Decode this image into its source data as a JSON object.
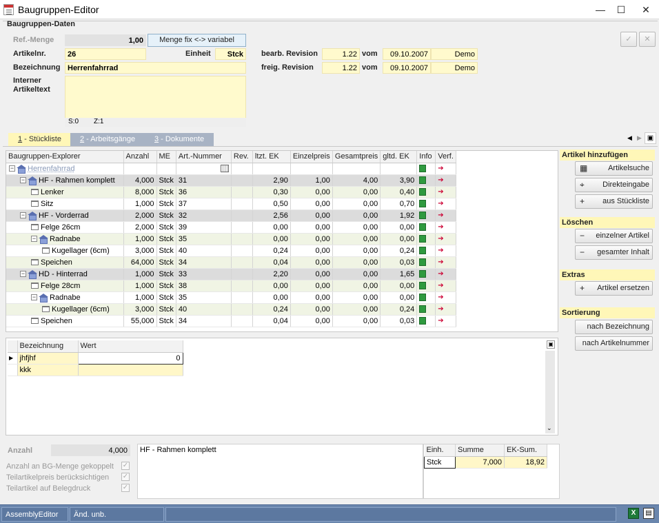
{
  "window": {
    "title": "Baugruppen-Editor",
    "min": "—",
    "max": "☐",
    "close": "✕"
  },
  "header": {
    "section": "Baugruppen-Daten",
    "ref_menge_label": "Ref.-Menge",
    "ref_menge_value": "1,00",
    "menge_button": "Menge fix <-> variabel",
    "artikelnr_label": "Artikelnr.",
    "artikelnr_value": "26",
    "einheit_label": "Einheit",
    "einheit_value": "Stck",
    "bezeichnung_label": "Bezeichnung",
    "bezeichnung_value": "Herrenfahrrad",
    "interner_label1": "Interner",
    "interner_label2": "Artikeltext",
    "text_status_s": "S:0",
    "text_status_z": "Z:1",
    "bearb_label": "bearb. Revision",
    "bearb_rev": "1.22",
    "bearb_vom": "vom",
    "bearb_date": "09.10.2007",
    "bearb_user": "Demo",
    "freig_label": "freig. Revision",
    "freig_rev": "1.22",
    "freig_vom": "vom",
    "freig_date": "09.10.2007",
    "freig_user": "Demo"
  },
  "tabs": [
    {
      "key": "1",
      "label": " - Stückliste"
    },
    {
      "key": "2",
      "label": " - Arbeitsgänge"
    },
    {
      "key": "3",
      "label": " - Dokumente"
    }
  ],
  "tree": {
    "columns": [
      "Baugruppen-Explorer",
      "Anzahl",
      "ME",
      "Art.-Nummer",
      "Rev.",
      "ltzt. EK",
      "Einzelpreis",
      "Gesamtpreis",
      "gltd. EK",
      "Info",
      "Verf."
    ],
    "rows": [
      {
        "name": "Herrenfahrrad",
        "anzahl": "",
        "me": "",
        "art": "",
        "ltzt": "",
        "einzel": "",
        "gesamt": "",
        "gltd": ""
      },
      {
        "name": "HF - Rahmen komplett",
        "anzahl": "4,000",
        "me": "Stck",
        "art": "31",
        "ltzt": "2,90",
        "einzel": "1,00",
        "gesamt": "4,00",
        "gltd": "3,90"
      },
      {
        "name": "Lenker",
        "anzahl": "8,000",
        "me": "Stck",
        "art": "36",
        "ltzt": "0,30",
        "einzel": "0,00",
        "gesamt": "0,00",
        "gltd": "0,40"
      },
      {
        "name": "Sitz",
        "anzahl": "1,000",
        "me": "Stck",
        "art": "37",
        "ltzt": "0,50",
        "einzel": "0,00",
        "gesamt": "0,00",
        "gltd": "0,70"
      },
      {
        "name": "HF - Vorderrad",
        "anzahl": "2,000",
        "me": "Stck",
        "art": "32",
        "ltzt": "2,56",
        "einzel": "0,00",
        "gesamt": "0,00",
        "gltd": "1,92"
      },
      {
        "name": "Felge 26cm",
        "anzahl": "2,000",
        "me": "Stck",
        "art": "39",
        "ltzt": "0,00",
        "einzel": "0,00",
        "gesamt": "0,00",
        "gltd": "0,00"
      },
      {
        "name": "Radnabe",
        "anzahl": "1,000",
        "me": "Stck",
        "art": "35",
        "ltzt": "0,00",
        "einzel": "0,00",
        "gesamt": "0,00",
        "gltd": "0,00"
      },
      {
        "name": "Kugellager (6cm)",
        "anzahl": "3,000",
        "me": "Stck",
        "art": "40",
        "ltzt": "0,24",
        "einzel": "0,00",
        "gesamt": "0,00",
        "gltd": "0,24"
      },
      {
        "name": "Speichen",
        "anzahl": "64,000",
        "me": "Stck",
        "art": "34",
        "ltzt": "0,04",
        "einzel": "0,00",
        "gesamt": "0,00",
        "gltd": "0,03"
      },
      {
        "name": "HD - Hinterrad",
        "anzahl": "1,000",
        "me": "Stck",
        "art": "33",
        "ltzt": "2,20",
        "einzel": "0,00",
        "gesamt": "0,00",
        "gltd": "1,65"
      },
      {
        "name": "Felge 28cm",
        "anzahl": "1,000",
        "me": "Stck",
        "art": "38",
        "ltzt": "0,00",
        "einzel": "0,00",
        "gesamt": "0,00",
        "gltd": "0,00"
      },
      {
        "name": "Radnabe",
        "anzahl": "1,000",
        "me": "Stck",
        "art": "35",
        "ltzt": "0,00",
        "einzel": "0,00",
        "gesamt": "0,00",
        "gltd": "0,00"
      },
      {
        "name": "Kugellager (6cm)",
        "anzahl": "3,000",
        "me": "Stck",
        "art": "40",
        "ltzt": "0,24",
        "einzel": "0,00",
        "gesamt": "0,00",
        "gltd": "0,24"
      },
      {
        "name": "Speichen",
        "anzahl": "55,000",
        "me": "Stck",
        "art": "34",
        "ltzt": "0,04",
        "einzel": "0,00",
        "gesamt": "0,00",
        "gltd": "0,03"
      }
    ]
  },
  "props": {
    "columns": [
      "Bezeichnung",
      "Wert"
    ],
    "rows": [
      {
        "name": "jhfjhf",
        "wert": "0"
      },
      {
        "name": "kkk",
        "wert": ""
      }
    ]
  },
  "sidebar": {
    "add_title": "Artikel hinzufügen",
    "add_buttons": [
      "Artikelsuche",
      "Direkteingabe",
      "aus Stückliste"
    ],
    "delete_title": "Löschen",
    "delete_buttons": [
      "einzelner Artikel",
      "gesamter Inhalt"
    ],
    "extras_title": "Extras",
    "extras_buttons": [
      "Artikel ersetzen"
    ],
    "sort_title": "Sortierung",
    "sort_buttons": [
      "nach Bezeichnung",
      "nach Artikelnummer"
    ]
  },
  "bottom": {
    "anzahl_label": "Anzahl",
    "anzahl_value": "4,000",
    "options": [
      "Anzahl an BG-Menge gekoppelt",
      "Teilartikelpreis berücksichtigen",
      "Teilartikel auf Belegdruck"
    ],
    "desc": "HF - Rahmen komplett",
    "sum_columns": [
      "Einh.",
      "Summe",
      "EK-Sum."
    ],
    "sum_row": [
      "Stck",
      "7,000",
      "18,92"
    ]
  },
  "status": {
    "cell1": "AssemblyEditor",
    "cell2": "Änd. unb."
  }
}
